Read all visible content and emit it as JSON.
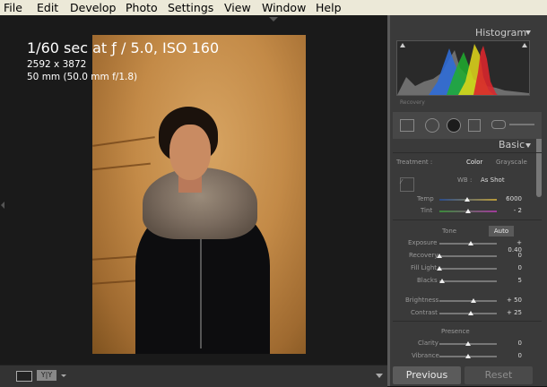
{
  "menu": {
    "file": "File",
    "edit": "Edit",
    "develop": "Develop",
    "photo": "Photo",
    "settings": "Settings",
    "view": "View",
    "window": "Window",
    "help": "Help"
  },
  "photo_info": {
    "exposure": "1/60 sec at ƒ / 5.0, ISO 160",
    "dimensions": "2592 x 3872",
    "lens": "50 mm (50.0 mm f/1.8)"
  },
  "histogram": {
    "title": "Histogram",
    "label": "Recovery"
  },
  "basic": {
    "title": "Basic",
    "treatment_label": "Treatment :",
    "color": "Color",
    "grayscale": "Grayscale",
    "wb_label": "WB :",
    "wb_value": "As Shot",
    "temp_label": "Temp",
    "temp_value": "6000",
    "temp_pos": 0.48,
    "tint_label": "Tint",
    "tint_value": "- 2",
    "tint_pos": 0.5,
    "tone_label": "Tone",
    "auto_label": "Auto",
    "exposure_label": "Exposure",
    "exposure_value": "+ 0.40",
    "exposure_pos": 0.55,
    "recovery_label": "Recovery",
    "recovery_value": "0",
    "recovery_pos": 0.0,
    "filllight_label": "Fill Light",
    "filllight_value": "0",
    "filllight_pos": 0.0,
    "blacks_label": "Blacks",
    "blacks_value": "5",
    "blacks_pos": 0.05,
    "brightness_label": "Brightness",
    "brightness_value": "+ 50",
    "brightness_pos": 0.6,
    "contrast_label": "Contrast",
    "contrast_value": "+ 25",
    "contrast_pos": 0.55,
    "presence_label": "Presence",
    "clarity_label": "Clarity",
    "clarity_value": "0",
    "clarity_pos": 0.5,
    "vibrance_label": "Vibrance",
    "vibrance_value": "0",
    "vibrance_pos": 0.5
  },
  "buttons": {
    "previous": "Previous",
    "reset": "Reset"
  },
  "icons": {
    "view_mode": "loupe-view-icon",
    "compare": "yy-compare-icon",
    "eyedropper": "eyedropper-icon"
  },
  "colors": {
    "panel_bg": "#3a3a3a",
    "menubar_bg": "#ece9d8"
  }
}
